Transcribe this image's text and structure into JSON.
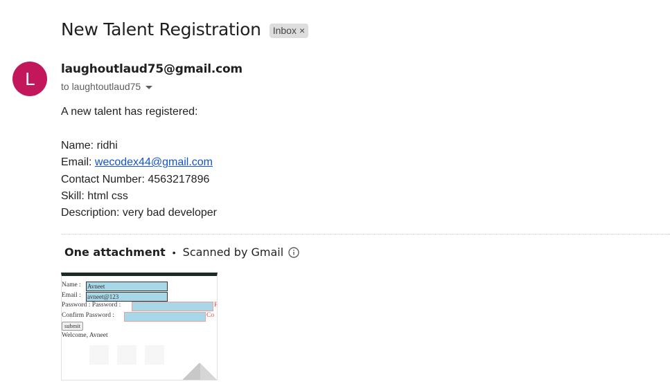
{
  "email": {
    "subject": "New Talent Registration",
    "label": "Inbox",
    "label_close": "×",
    "avatar_letter": "L",
    "avatar_color": "#c2185b",
    "sender": "laughoutlaud75@gmail.com",
    "to_line": "to laughtoutlaud75",
    "intro": "A new talent has registered:",
    "fields": {
      "name": "Name: ridhi",
      "email_label": "Email: ",
      "email_value": "wecodex44@gmail.com",
      "contact": "Contact Number: 4563217896",
      "skill": "Skill: html css",
      "description": "Description: very bad developer"
    }
  },
  "attachments": {
    "title": "One attachment",
    "separator": "•",
    "scanned": "Scanned by Gmail",
    "thumbnail": {
      "name_label": "Name :",
      "name_value": "Avneet",
      "email_label": "Email :",
      "email_value": "avneet@123",
      "password_label": "Password : Password :",
      "password_hint": "P",
      "confirm_label": "Confirm Password :",
      "confirm_hint": "Co",
      "submit": "submit",
      "welcome": "Welcome, Avneet"
    }
  }
}
